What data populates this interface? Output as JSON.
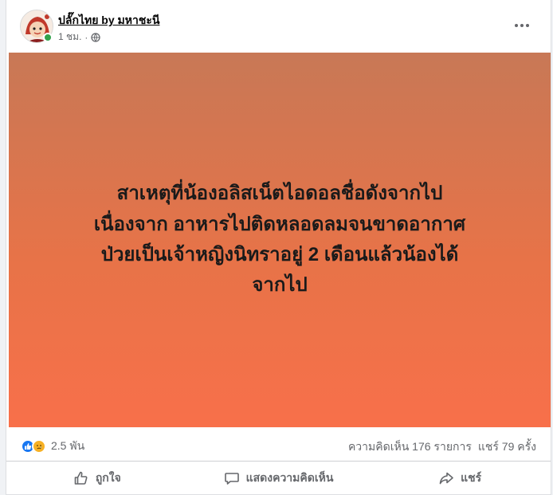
{
  "post": {
    "page_name": "ปลั๊กไทย by มหาชะนี",
    "time": "1 ชม.",
    "image_text": [
      "สาเหตุที่น้องอลิสเน็ตไอดอลชื่อดังจากไป",
      "เนื่องจาก อาหารไปติดหลอดลมจนขาดอากาศ",
      "ป่วยเป็นเจ้าหญิงนิทราอยู่ 2 เดือนแล้วน้องได้",
      "จากไป"
    ]
  },
  "stats": {
    "reaction_count": "2.5 พัน",
    "comments": "ความคิดเห็น 176 รายการ",
    "shares": "แชร์ 79 ครั้ง"
  },
  "actions": {
    "like": "ถูกใจ",
    "comment": "แสดงความคิดเห็น",
    "share": "แชร์"
  },
  "colors": {
    "accent_like": "#1877f2",
    "sad_reaction": "#f7b125",
    "online": "#31a24c",
    "image_top": "#c87856",
    "image_bottom": "#f8704a"
  },
  "icons": {
    "more": "more-horizontal-icon",
    "privacy": "globe-icon",
    "like_reaction": "thumbs-up-icon",
    "sad_reaction": "sad-face-icon",
    "like_action": "thumbs-up-outline-icon",
    "comment_action": "speech-bubble-icon",
    "share_action": "share-arrow-icon"
  }
}
